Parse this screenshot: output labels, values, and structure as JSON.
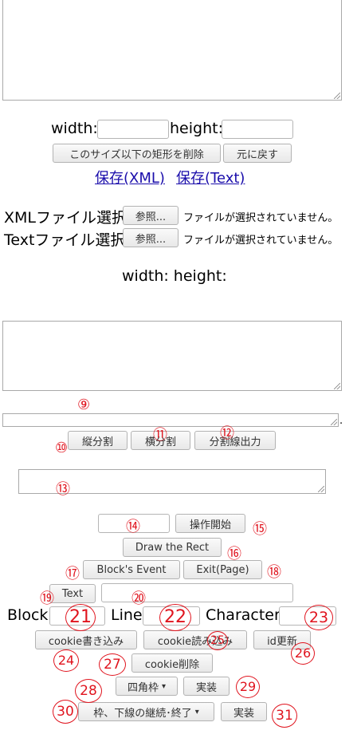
{
  "size": {
    "width_label": "width:",
    "height_label": "height:",
    "delete_small_rects_button": "このサイズ以下の矩形を削除",
    "undo_button": "元に戻す",
    "save_xml_link": "保存(XML)",
    "save_text_link": "保存(Text)"
  },
  "files": {
    "xml_label": "XMLファイル選択",
    "text_label": "Textファイル選択",
    "browse_button": "参照...",
    "no_file_text": "ファイルが選択されていません。"
  },
  "dims": {
    "text": "width: height:"
  },
  "split": {
    "trailing_dot": ".",
    "vertical_split_button": "縦分割",
    "horizontal_split_button": "横分割",
    "output_lines_button": "分割線出力"
  },
  "ops": {
    "start_button": "操作開始",
    "draw_rect_button": "Draw the Rect",
    "block_event_button": "Block's Event",
    "exit_page_button": "Exit(Page)",
    "text_button": "Text",
    "block_label": "Block",
    "line_label": "Line",
    "character_label": "Character",
    "cookie_write_button": "cookie書き込み",
    "cookie_read_button": "cookie読み込み",
    "id_update_button": "id更新",
    "cookie_delete_button": "cookie削除",
    "shape_select_value": "四角枠",
    "implement_button": "実装",
    "border_select_value": "枠、下線の継続･終了"
  },
  "annotations": {
    "n9": "⑨",
    "n10": "⑩",
    "n11": "⑪",
    "n12": "⑫",
    "n13": "⑬",
    "n14": "⑭",
    "n15": "⑮",
    "n16": "⑯",
    "n17": "⑰",
    "n18": "⑱",
    "n19": "⑲",
    "n20": "⑳",
    "n21": "21",
    "n22": "22",
    "n23": "23",
    "n24": "24",
    "n25": "25",
    "n26": "26",
    "n27": "27",
    "n28": "28",
    "n29": "29",
    "n30": "30",
    "n31": "31"
  },
  "colors": {
    "annotation": "#e0141e",
    "link": "#1a0dab"
  }
}
